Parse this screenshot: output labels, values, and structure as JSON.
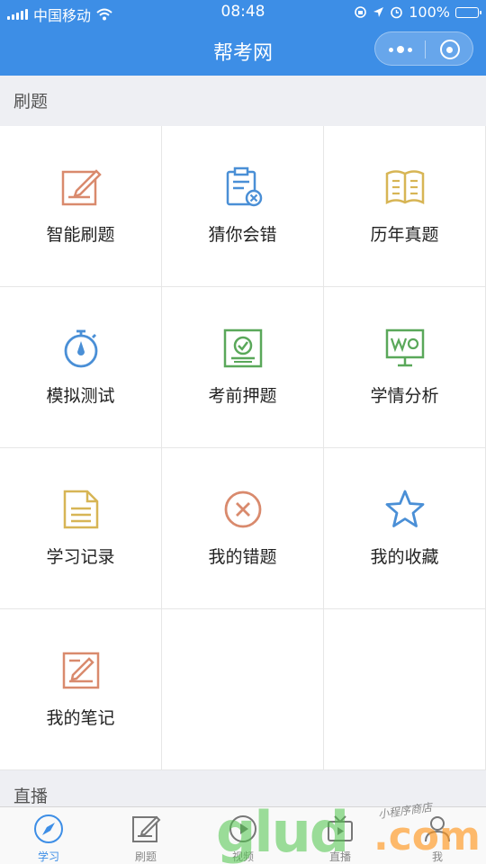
{
  "status_bar": {
    "carrier": "中国移动",
    "time": "08:48",
    "battery": "100%"
  },
  "nav": {
    "title": "帮考网"
  },
  "sections": {
    "practice_title": "刷题",
    "live_title": "直播"
  },
  "grid_items": [
    {
      "label": "智能刷题",
      "icon": "edit-note-icon",
      "color": "#d98a6d"
    },
    {
      "label": "猜你会错",
      "icon": "clipboard-x-icon",
      "color": "#4a8fd6"
    },
    {
      "label": "历年真题",
      "icon": "open-book-icon",
      "color": "#d7b555"
    },
    {
      "label": "模拟测试",
      "icon": "stopwatch-icon",
      "color": "#4a8fd6"
    },
    {
      "label": "考前押题",
      "icon": "certificate-icon",
      "color": "#5aa85a"
    },
    {
      "label": "学情分析",
      "icon": "presentation-board-icon",
      "color": "#5aa85a"
    },
    {
      "label": "学习记录",
      "icon": "document-icon",
      "color": "#d7b555"
    },
    {
      "label": "我的错题",
      "icon": "circle-x-icon",
      "color": "#d98a6d"
    },
    {
      "label": "我的收藏",
      "icon": "star-icon",
      "color": "#4a8fd6"
    },
    {
      "label": "我的笔记",
      "icon": "note-pencil-icon",
      "color": "#d98a6d"
    }
  ],
  "tabs": [
    {
      "label": "学习",
      "icon": "compass-icon",
      "active": true
    },
    {
      "label": "刷题",
      "icon": "edit-note-icon",
      "active": false
    },
    {
      "label": "视频",
      "icon": "video-icon",
      "active": false
    },
    {
      "label": "直播",
      "icon": "live-tv-icon",
      "active": false
    },
    {
      "label": "我",
      "icon": "user-icon",
      "active": false
    }
  ],
  "watermark": {
    "main": "glud",
    "suffix": ".com",
    "handwriting": "小程序商店"
  },
  "colors": {
    "primary": "#3d8ee6",
    "background": "#eeeff3"
  }
}
